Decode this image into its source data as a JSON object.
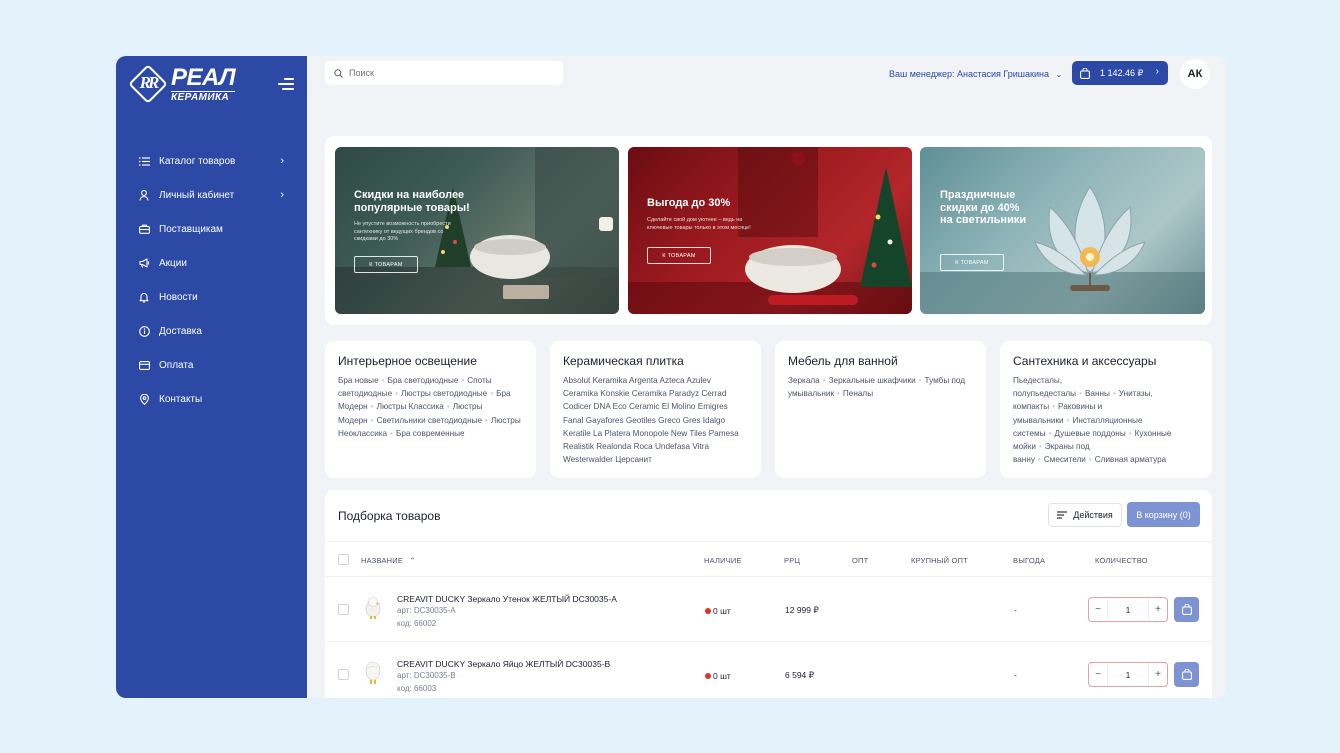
{
  "brand": {
    "line1": "РЕАЛ",
    "line2": "КЕРАМИКА",
    "mark": "RR"
  },
  "sidebar": {
    "items": [
      {
        "label": "Каталог товаров",
        "icon": "list-icon",
        "has_submenu": true
      },
      {
        "label": "Личный кабинет",
        "icon": "user-icon",
        "has_submenu": true
      },
      {
        "label": "Поставщикам",
        "icon": "briefcase-icon",
        "has_submenu": false
      },
      {
        "label": "Акции",
        "icon": "megaphone-icon",
        "has_submenu": false
      },
      {
        "label": "Новости",
        "icon": "bell-icon",
        "has_submenu": false
      },
      {
        "label": "Доставка",
        "icon": "info-icon",
        "has_submenu": false
      },
      {
        "label": "Оплата",
        "icon": "card-icon",
        "has_submenu": false
      },
      {
        "label": "Контакты",
        "icon": "pin-icon",
        "has_submenu": false
      }
    ]
  },
  "header": {
    "search_placeholder": "Поиск",
    "manager": "Ваш менеджер: Анастасия Гришакина",
    "cart_amount": "1 142.46 ₽",
    "avatar": "АК"
  },
  "banners": [
    {
      "title": "Скидки на наиболее популярные товары!",
      "desc": "Не упустите возможность приобрести сантехнику от ведущих брендов со скидками до 30%",
      "cta": "К ТОВАРАМ"
    },
    {
      "title": "Выгода до 30%",
      "desc": "Сделайте свой дом уютнее – ведь на ключевые товары только в этом месяце!",
      "cta": "К ТОВАРАМ"
    },
    {
      "title": "Праздничные скидки до 40% на светильники",
      "desc": "",
      "cta": "К ТОВАРАМ"
    }
  ],
  "categories": [
    {
      "title": "Интерьерное освещение",
      "tags": [
        "Бра новые",
        "Бра светодиодные",
        "Споты светодиодные",
        "Люстры светодиодные",
        "Бра Модерн",
        "Люстры Классика",
        "Люстры Модерн",
        "Светильники светодиодные",
        "Люстры Неоклассика",
        "Бра современные"
      ]
    },
    {
      "title": "Керамическая плитка",
      "tags": [
        "Absolut Keramika",
        "Argenta",
        "Azteca",
        "Azulev",
        "Ceramika Konskie",
        "Ceramika Paradyz",
        "Cerrad",
        "Codicer",
        "DNA",
        "Eco Ceramic",
        "El Molino",
        "Emigres",
        "Fanal",
        "Gayafores",
        "Geotiles",
        "Greco Gres",
        "Idalgo",
        "Keratile",
        "La Platera",
        "Monopole",
        "New Tiles",
        "Pamesa",
        "Realistik",
        "Realonda",
        "Roca",
        "Undefasa",
        "Vitra",
        "Westerwalder",
        "Церсанит"
      ],
      "plain": true
    },
    {
      "title": "Мебель для ванной",
      "tags": [
        "Зеркала",
        "Зеркальные шкафчики",
        "Тумбы под умывальник",
        "Пеналы"
      ]
    },
    {
      "title": "Сантехника и аксессуары",
      "tags": [
        "Пьедесталы, полупьедесталы",
        "Ванны",
        "Унитазы, компакты",
        "Раковины и умывальники",
        "Инсталляционные системы",
        "Душевые поддоны",
        "Кухонные мойки",
        "Экраны под ванну",
        "Смесители",
        "Сливная арматура"
      ]
    }
  ],
  "products": {
    "title": "Подборка товаров",
    "actions_label": "Действия",
    "to_cart_label": "В корзину (0)",
    "columns": {
      "name": "НАЗВАНИЕ",
      "availability": "НАЛИЧИЕ",
      "rrc": "РРЦ",
      "opt": "ОПТ",
      "big_opt": "КРУПНЫЙ ОПТ",
      "gain": "ВЫГОДА",
      "qty": "КОЛИЧЕСТВО"
    },
    "rows": [
      {
        "name": "CREAVIT DUCKY Зеркало Утенок ЖЕЛТЫЙ DC30035-A",
        "art": "арт: DC30035-A",
        "code": "код: 66002",
        "availability": "0 шт",
        "rrc": "12 999 ₽",
        "opt": "",
        "big_opt": "",
        "gain": "-",
        "qty": "1"
      },
      {
        "name": "CREAVIT DUCKY Зеркало Яйцо ЖЕЛТЫЙ DC30035-B",
        "art": "арт: DC30035-B",
        "code": "код: 66003",
        "availability": "0 шт",
        "rrc": "6 594 ₽",
        "opt": "",
        "big_opt": "",
        "gain": "-",
        "qty": "1"
      }
    ]
  },
  "colors": {
    "brand_blue": "#2c49a6",
    "soft_blue": "#7d93d3",
    "out_of_stock": "#e2312b",
    "background": "#e4f2fb"
  }
}
